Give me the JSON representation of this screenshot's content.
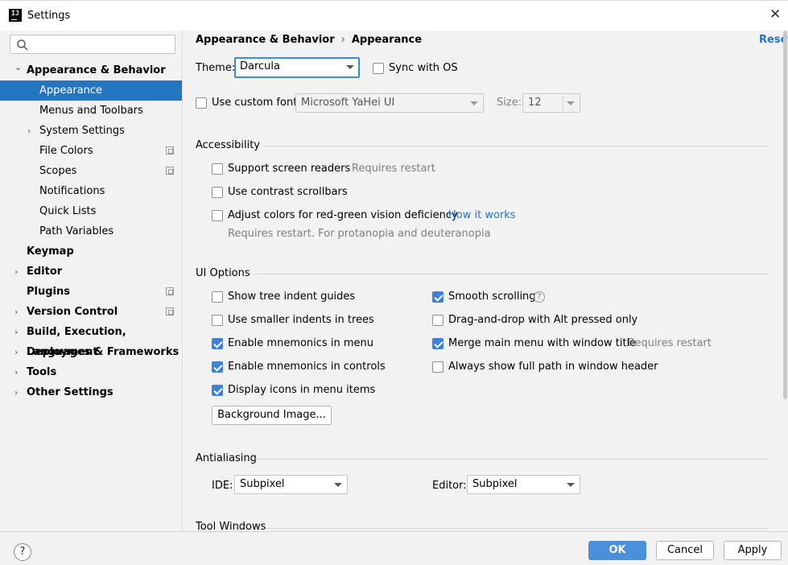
{
  "window": {
    "title": "Settings",
    "close_glyph": "✕",
    "app_icon_text": "IJ"
  },
  "sidebar": {
    "search": {
      "value": "",
      "placeholder": ""
    },
    "items": [
      {
        "label": "Appearance & Behavior",
        "bold": true,
        "expanded": true
      },
      {
        "label": "Appearance",
        "selected": true
      },
      {
        "label": "Menus and Toolbars"
      },
      {
        "label": "System Settings",
        "collapsed": true
      },
      {
        "label": "File Colors",
        "project_icon": true
      },
      {
        "label": "Scopes",
        "project_icon": true
      },
      {
        "label": "Notifications"
      },
      {
        "label": "Quick Lists"
      },
      {
        "label": "Path Variables"
      },
      {
        "label": "Keymap",
        "bold": true
      },
      {
        "label": "Editor",
        "bold": true,
        "collapsed": true
      },
      {
        "label": "Plugins",
        "bold": true,
        "project_icon": true
      },
      {
        "label": "Version Control",
        "bold": true,
        "collapsed": true,
        "project_icon": true
      },
      {
        "label": "Build, Execution, Deployment",
        "bold": true,
        "collapsed": true
      },
      {
        "label": "Languages & Frameworks",
        "bold": true,
        "collapsed": true
      },
      {
        "label": "Tools",
        "bold": true,
        "collapsed": true
      },
      {
        "label": "Other Settings",
        "bold": true,
        "collapsed": true
      }
    ]
  },
  "main": {
    "breadcrumb": {
      "parent": "Appearance & Behavior",
      "separator": "›",
      "current": "Appearance"
    },
    "reset_label": "Reset",
    "theme": {
      "label": "Theme:",
      "value": "Darcula",
      "sync_label": "Sync with OS",
      "sync_checked": false
    },
    "font": {
      "custom_label": "Use custom font:",
      "custom_checked": false,
      "value": "Microsoft YaHei UI",
      "size_label": "Size:",
      "size_value": "12"
    },
    "accessibility": {
      "title": "Accessibility",
      "screen_readers": {
        "label": "Support screen readers",
        "note": "Requires restart",
        "checked": false
      },
      "contrast_scrollbars": {
        "label": "Use contrast scrollbars",
        "checked": false
      },
      "red_green": {
        "label": "Adjust colors for red-green vision deficiency",
        "link": "How it works",
        "note": "Requires restart. For protanopia and deuteranopia",
        "checked": false
      }
    },
    "ui_options": {
      "title": "UI Options",
      "left": [
        {
          "label": "Show tree indent guides",
          "checked": false
        },
        {
          "label": "Use smaller indents in trees",
          "checked": false
        },
        {
          "label": "Enable mnemonics in menu",
          "checked": true
        },
        {
          "label": "Enable mnemonics in controls",
          "checked": true
        },
        {
          "label": "Display icons in menu items",
          "checked": true
        }
      ],
      "right": [
        {
          "label": "Smooth scrolling",
          "checked": true,
          "help": "?"
        },
        {
          "label": "Drag-and-drop with Alt pressed only",
          "checked": false
        },
        {
          "label": "Merge main menu with window title",
          "checked": true,
          "note": "Requires restart"
        },
        {
          "label": "Always show full path in window header",
          "checked": false
        }
      ],
      "background_button": "Background Image..."
    },
    "antialiasing": {
      "title": "Antialiasing",
      "ide_label": "IDE:",
      "ide_value": "Subpixel",
      "editor_label": "Editor:",
      "editor_value": "Subpixel"
    },
    "tool_windows_title": "Tool Windows"
  },
  "footer": {
    "help": "?",
    "ok": "OK",
    "cancel": "Cancel",
    "apply": "Apply"
  },
  "colors": {
    "accent": "#2675BF",
    "selection": "#2675BF",
    "checkbox": "#3D82D6",
    "background": "#F2F2F2"
  }
}
